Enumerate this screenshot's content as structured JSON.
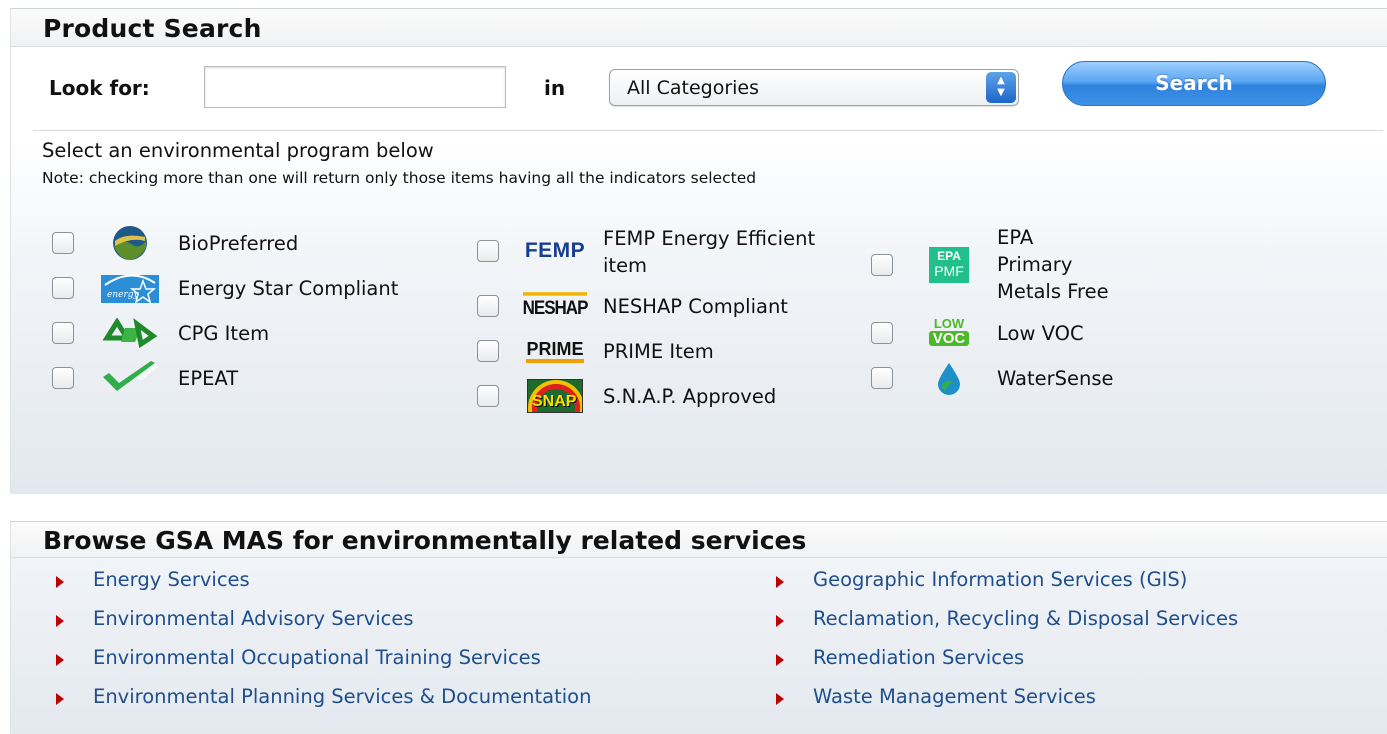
{
  "search": {
    "title": "Product Search",
    "look_for_label": "Look for:",
    "query_value": "",
    "query_placeholder": "",
    "in_label": "in",
    "category_selected": "All Categories",
    "search_button": "Search"
  },
  "programs": {
    "heading": "Select an environmental program below",
    "note": "Note: checking more than one will return only those items having all the indicators selected",
    "column1": [
      {
        "label": "BioPreferred",
        "icon": "biopreferred-logo",
        "checked": false
      },
      {
        "label": "Energy Star Compliant",
        "icon": "energy-star-logo",
        "checked": false
      },
      {
        "label": "CPG Item",
        "icon": "cpg-recycle-logo",
        "checked": false
      },
      {
        "label": "EPEAT",
        "icon": "epeat-logo",
        "checked": false
      }
    ],
    "column2": [
      {
        "label_line1": "FEMP Energy Efficient",
        "label_line2": "item",
        "icon": "femp-logo",
        "logo_text": "FEMP",
        "checked": false
      },
      {
        "label": "NESHAP Compliant",
        "icon": "neshap-logo",
        "logo_text": "NESHAP",
        "checked": false
      },
      {
        "label": "PRIME Item",
        "icon": "prime-logo",
        "logo_text": "PRIME",
        "checked": false
      },
      {
        "label": "S.N.A.P. Approved",
        "icon": "snap-logo",
        "logo_text": "SNAP",
        "checked": false
      }
    ],
    "column3": [
      {
        "label_line1": "EPA",
        "label_line2": "Primary",
        "label_line3": "Metals Free",
        "icon": "epa-pmf-logo",
        "logo_text_top": "EPA",
        "logo_text_bottom": "PMF",
        "checked": false
      },
      {
        "label": "Low VOC",
        "icon": "low-voc-logo",
        "logo_text_top": "LOW",
        "logo_text_bottom": "VOC",
        "checked": false
      },
      {
        "label": "WaterSense",
        "icon": "watersense-drop-logo",
        "checked": false
      }
    ]
  },
  "browse": {
    "title": "Browse GSA MAS for environmentally related services",
    "left_links": [
      "Energy Services",
      "Environmental Advisory Services",
      "Environmental Occupational Training Services",
      "Environmental Planning Services & Documentation"
    ],
    "right_links": [
      "Geographic Information Services (GIS)",
      "Reclamation, Recycling & Disposal Services",
      "Remediation Services",
      "Waste Management Services"
    ]
  },
  "colors": {
    "link": "#1f4e8c",
    "bullet": "#c00000",
    "button": "#3f92e8"
  }
}
